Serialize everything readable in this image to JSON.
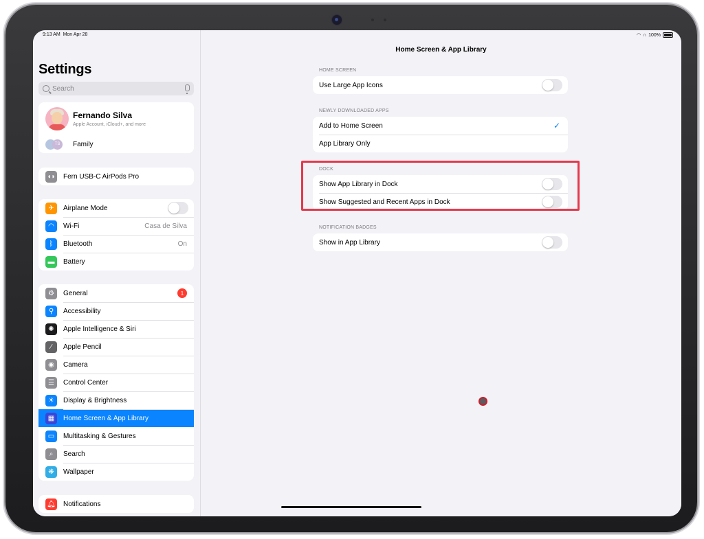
{
  "status": {
    "time": "9:13 AM",
    "date": "Mon Apr 28",
    "battery": "100%"
  },
  "sidebar": {
    "title": "Settings",
    "search_placeholder": "Search",
    "profile": {
      "name": "Fernando Silva",
      "subtitle": "Apple Account, iCloud+, and more"
    },
    "family": {
      "label": "Family",
      "initials": "TS"
    },
    "airpods": {
      "label": "Fern USB-C AirPods Pro"
    },
    "connectivity": [
      {
        "label": "Airplane Mode",
        "icon": "airplane-icon",
        "color": "#ff9500"
      },
      {
        "label": "Wi-Fi",
        "value": "Casa de Silva",
        "icon": "wifi-icon",
        "color": "#0a84ff"
      },
      {
        "label": "Bluetooth",
        "value": "On",
        "icon": "bluetooth-icon",
        "color": "#0a84ff"
      },
      {
        "label": "Battery",
        "icon": "battery-icon",
        "color": "#34c759"
      }
    ],
    "general_items": [
      {
        "label": "General",
        "badge": "1",
        "icon": "gear-icon",
        "color": "#8e8e93"
      },
      {
        "label": "Accessibility",
        "icon": "accessibility-icon",
        "color": "#0a84ff"
      },
      {
        "label": "Apple Intelligence & Siri",
        "icon": "siri-icon",
        "color": "#1c1c1e"
      },
      {
        "label": "Apple Pencil",
        "icon": "pencil-icon",
        "color": "#636366"
      },
      {
        "label": "Camera",
        "icon": "camera-icon",
        "color": "#8e8e93"
      },
      {
        "label": "Control Center",
        "icon": "control-center-icon",
        "color": "#8e8e93"
      },
      {
        "label": "Display & Brightness",
        "icon": "brightness-icon",
        "color": "#0a84ff"
      },
      {
        "label": "Home Screen & App Library",
        "icon": "home-screen-icon",
        "color": "#3a46d8",
        "selected": true
      },
      {
        "label": "Multitasking & Gestures",
        "icon": "multitasking-icon",
        "color": "#0a84ff"
      },
      {
        "label": "Search",
        "icon": "search-icon",
        "color": "#8e8e93"
      },
      {
        "label": "Wallpaper",
        "icon": "wallpaper-icon",
        "color": "#32ade6"
      }
    ],
    "notifications": {
      "label": "Notifications",
      "icon": "bell-icon",
      "color": "#ff3b30"
    }
  },
  "detail": {
    "title": "Home Screen & App Library",
    "sections": {
      "home_screen": {
        "header": "HOME SCREEN",
        "rows": [
          {
            "label": "Use Large App Icons",
            "on": false
          }
        ]
      },
      "new_apps": {
        "header": "NEWLY DOWNLOADED APPS",
        "rows": [
          {
            "label": "Add to Home Screen",
            "checked": true
          },
          {
            "label": "App Library Only"
          }
        ]
      },
      "dock": {
        "header": "DOCK",
        "rows": [
          {
            "label": "Show App Library in Dock",
            "on": false
          },
          {
            "label": "Show Suggested and Recent Apps in Dock",
            "on": false
          }
        ]
      },
      "badges": {
        "header": "NOTIFICATION BADGES",
        "rows": [
          {
            "label": "Show in App Library",
            "on": false
          }
        ]
      }
    },
    "checkmark": "✓"
  },
  "colors": {
    "accent": "#0a84ff",
    "highlight": "#e5384c",
    "badge": "#ff3b30"
  }
}
